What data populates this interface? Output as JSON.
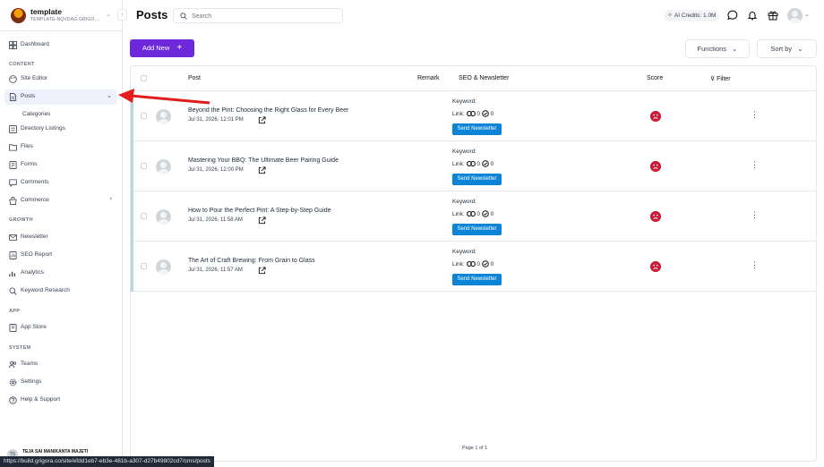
{
  "sidebar": {
    "brand": {
      "name": "template",
      "subtitle": "TEMPLATE-NQVDAG.GRIGOR..."
    },
    "items": {
      "dashboard": "Dashboard",
      "site_editor": "Site Editor",
      "posts": "Posts",
      "categories": "Categories",
      "directory_listings": "Directory Listings",
      "files": "Files",
      "forms": "Forms",
      "comments": "Comments",
      "commerce": "Commerce",
      "newsletter": "Newsletter",
      "seo_report": "SEO Report",
      "analytics": "Analytics",
      "keyword_research": "Keyword Research",
      "app_store": "App Store",
      "teams": "Teams",
      "settings": "Settings",
      "help_support": "Help & Support"
    },
    "sections": {
      "content": "CONTENT",
      "growth": "GROWTH",
      "app": "APP",
      "system": "SYSTEM"
    },
    "user": {
      "initials": "TS",
      "name": "TEJA SAI MANIKANTA MAJETI"
    }
  },
  "header": {
    "title": "Posts",
    "search_placeholder": "Search",
    "credits": "AI Credits: 1.0M"
  },
  "toolbar": {
    "add_new": "Add New",
    "add_icon": "+",
    "functions": "Functions",
    "sort_by": "Sort by"
  },
  "table": {
    "headers": {
      "post": "Post",
      "remark": "Remark",
      "seo": "SEO & Newsletter",
      "score": "Score",
      "filter": "Filter"
    },
    "keyword_label": "Keyword:",
    "link_label": "Link:",
    "send_label": "Send Newsletter",
    "rows": [
      {
        "title": "Beyond the Pint: Choosing the Right Glass for Every Beer",
        "date": "Jul 31, 2026, 12:01 PM",
        "links": "0",
        "checks": "0"
      },
      {
        "title": "Mastering Your BBQ: The Ultimate Beer Pairing Guide",
        "date": "Jul 31, 2026, 12:00 PM",
        "links": "0",
        "checks": "0"
      },
      {
        "title": "How to Pour the Perfect Pint: A Step-by-Step Guide",
        "date": "Jul 31, 2026, 11:58 AM",
        "links": "0",
        "checks": "0"
      },
      {
        "title": "The Art of Craft Brewing: From Grain to Glass",
        "date": "Jul 31, 2026, 11:57 AM",
        "links": "0",
        "checks": "0"
      }
    ],
    "pager": "Page 1 of 1"
  },
  "status_url": "https://build.grigora.co/site/efdd1eb7-eb3e-481b-a307-d27b49802cd7/cms/posts",
  "colors": {
    "accent": "#6d28d9",
    "send": "#0b84d8",
    "score_bad": "#c81e3a",
    "annotation": "#e11d1d"
  }
}
